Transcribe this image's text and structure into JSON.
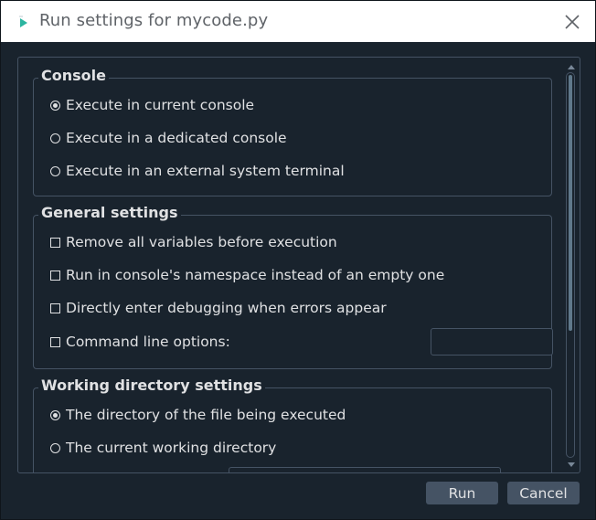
{
  "window": {
    "title": "Run settings for mycode.py"
  },
  "icons": {
    "app": "spyder-run-icon",
    "close": "close-icon"
  },
  "console_group": {
    "title": "Console",
    "options": [
      {
        "label": "Execute in current console",
        "checked": true
      },
      {
        "label": "Execute in a dedicated console",
        "checked": false
      },
      {
        "label": "Execute in an external system terminal",
        "checked": false
      }
    ]
  },
  "general_group": {
    "title": "General settings",
    "options": [
      {
        "label": "Remove all variables before execution",
        "checked": false
      },
      {
        "label": "Run in console's namespace instead of an empty one",
        "checked": false
      },
      {
        "label": "Directly enter debugging when errors appear",
        "checked": false
      },
      {
        "label": "Command line options:",
        "checked": false
      }
    ],
    "command_line_value": ""
  },
  "working_dir_group": {
    "title": "Working directory settings",
    "options": [
      {
        "label": "The directory of the file being executed",
        "checked": true
      },
      {
        "label": "The current working directory",
        "checked": false
      }
    ]
  },
  "buttons": {
    "run": "Run",
    "cancel": "Cancel"
  },
  "colors": {
    "background": "#19232d",
    "border": "#455364",
    "text": "#e0e1e3",
    "button": "#455364",
    "titlebar": "#ffffff"
  }
}
